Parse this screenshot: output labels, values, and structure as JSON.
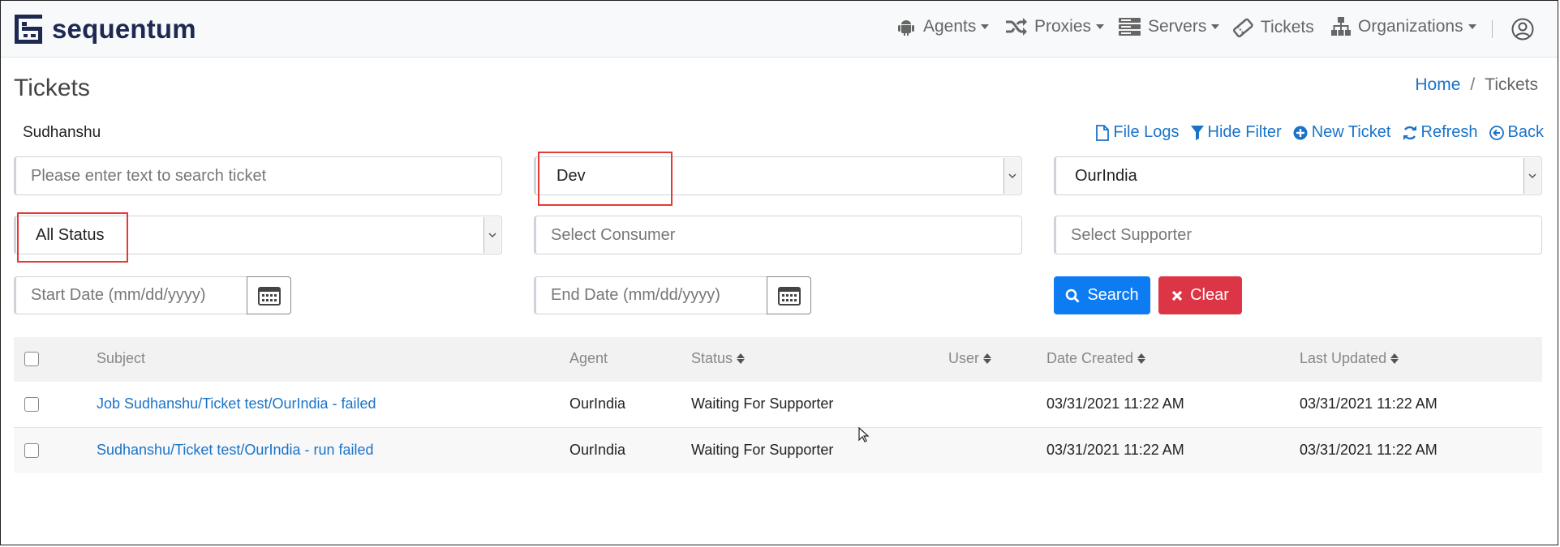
{
  "app": {
    "logo_text": "sequentum"
  },
  "nav": {
    "agents": "Agents",
    "proxies": "Proxies",
    "servers": "Servers",
    "tickets": "Tickets",
    "organizations": "Organizations"
  },
  "page": {
    "title": "Tickets"
  },
  "breadcrumb": {
    "home": "Home",
    "current": "Tickets"
  },
  "filter": {
    "user_name": "Sudhanshu",
    "search_placeholder": "Please enter text to search ticket",
    "environment_value": "Dev",
    "organization_value": "OurIndia",
    "status_value": "All Status",
    "consumer_placeholder": "Select Consumer",
    "supporter_placeholder": "Select Supporter",
    "start_date_placeholder": "Start Date (mm/dd/yyyy)",
    "end_date_placeholder": "End Date (mm/dd/yyyy)",
    "search_button": "Search",
    "clear_button": "Clear"
  },
  "actions": {
    "file_logs": "File Logs",
    "hide_filter": "Hide Filter",
    "new_ticket": "New Ticket",
    "refresh": "Refresh",
    "back": "Back"
  },
  "table": {
    "columns": {
      "subject": "Subject",
      "agent": "Agent",
      "status": "Status",
      "user": "User",
      "date_created": "Date Created",
      "last_updated": "Last Updated"
    },
    "rows": [
      {
        "subject": "Job Sudhanshu/Ticket test/OurIndia - failed",
        "agent": "OurIndia",
        "status": "Waiting For Supporter",
        "user": "",
        "date_created": "03/31/2021 11:22 AM",
        "last_updated": "03/31/2021 11:22 AM"
      },
      {
        "subject": "Sudhanshu/Ticket test/OurIndia - run failed",
        "agent": "OurIndia",
        "status": "Waiting For Supporter",
        "user": "",
        "date_created": "03/31/2021 11:22 AM",
        "last_updated": "03/31/2021 11:22 AM"
      }
    ]
  },
  "colors": {
    "brand": "#1e2952",
    "link": "#1a73c8",
    "primary_button": "#0d7bf2",
    "danger_button": "#dc3545",
    "highlight": "#e53935"
  }
}
